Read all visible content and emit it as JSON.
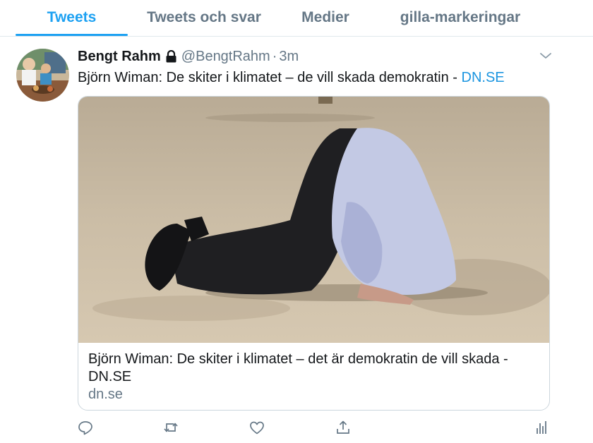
{
  "tabs": [
    {
      "label": "Tweets",
      "active": true
    },
    {
      "label": "Tweets och svar",
      "active": false
    },
    {
      "label": "Medier",
      "active": false
    },
    {
      "label": "gilla-markeringar",
      "active": false
    }
  ],
  "tweet": {
    "display_name": "Bengt Rahm",
    "handle": "@BengtRahm",
    "separator": "·",
    "time": "3m",
    "text": "Björn Wiman: De skiter i klimatet – de vill skada demokratin - ",
    "link_text": "DN.SE"
  },
  "card": {
    "title": "Björn Wiman: De skiter i klimatet – det är demokratin de vill skada - DN.SE",
    "domain": "dn.se"
  },
  "actions": [
    "reply-icon",
    "retweet-icon",
    "like-icon",
    "share-icon",
    "analytics-icon"
  ],
  "colors": {
    "accent": "#1da1f2",
    "link": "#1b95e0",
    "secondary_text": "#657786",
    "border": "#ccd6dd"
  }
}
